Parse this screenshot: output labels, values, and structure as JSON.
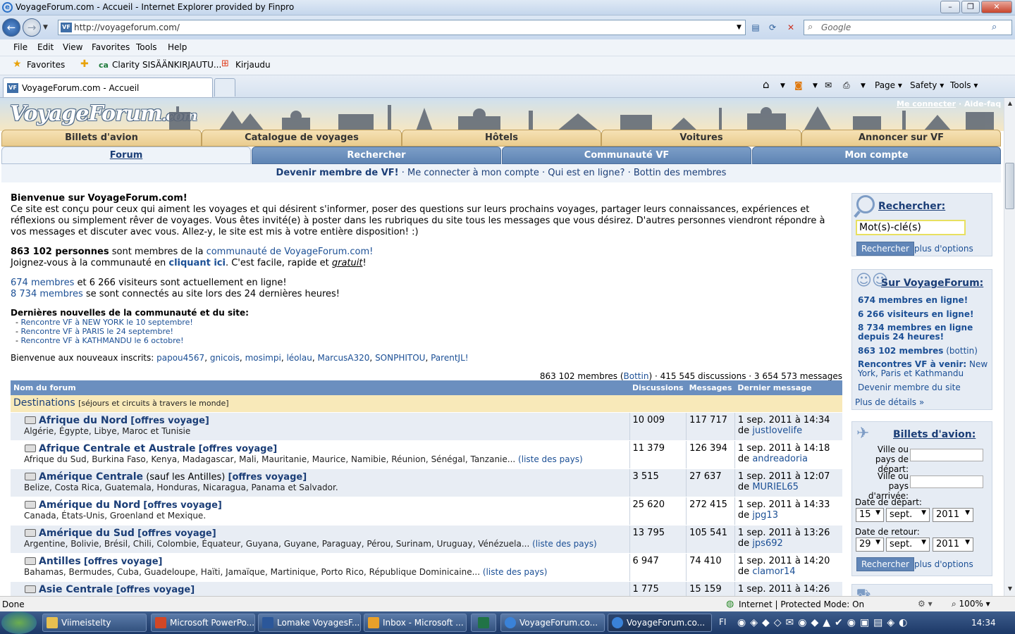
{
  "window": {
    "title": "VoyageForum.com - Accueil - Internet Explorer provided by Finpro",
    "address": "http://voyageforum.com/",
    "search_placeholder": "Google"
  },
  "menu": [
    "File",
    "Edit",
    "View",
    "Favorites",
    "Tools",
    "Help"
  ],
  "favorites_bar": {
    "favorites_label": "Favorites",
    "items": [
      "Clarity SISÄÄNKIRJAUTU...",
      "Kirjaudu"
    ]
  },
  "tab": {
    "title": "VoyageForum.com - Accueil"
  },
  "command_bar": {
    "page": "Page",
    "safety": "Safety",
    "tools": "Tools"
  },
  "site": {
    "logo": "VoyageForum",
    "logo_suffix": ".com",
    "top_links": {
      "login": "Me connecter",
      "separator": " · ",
      "help": "Aide-faq"
    },
    "nav_top": [
      "Billets d'avion",
      "Catalogue de voyages",
      "Hôtels",
      "Voitures",
      "Annoncer sur VF"
    ],
    "nav_main": [
      "Forum",
      "Rechercher",
      "Communauté VF",
      "Mon compte"
    ],
    "subnav": {
      "become_member": "Devenir membre de VF!",
      "login": "Me connecter à mon compte",
      "who_online": "Qui est en ligne?",
      "directory": "Bottin des membres",
      "sep": " · "
    },
    "welcome": {
      "title": "Bienvenue sur VoyageForum.com!",
      "text": "Ce site est conçu pour ceux qui aiment les voyages et qui désirent s'informer, poser des questions sur leurs prochains voyages, partager leurs connaissances, expériences et réflexions ou simplement rêver de voyages. Vous êtes invité(e) à poster dans les rubriques du site tous les messages que vous désirez. D'autres personnes viendront répondre à vos messages et discuter avec vous. Allez-y, le site est mis à votre entière disposition! :)"
    },
    "members": {
      "count": "863 102 personnes",
      "are_members": " sont membres de la ",
      "community_link": "communauté de VoyageForum.com!",
      "join_pre": "Joignez-vous à la communauté en ",
      "join_link": "cliquant ici",
      "join_post": ". C'est facile, rapide et ",
      "free": "gratuit",
      "bang": "!"
    },
    "online": {
      "members_online": "674 membres",
      "online_rest": " et 6 266 visiteurs sont actuellement en ligne!",
      "members_24h": "8 734 membres",
      "rest_24h": " se sont connectés au site lors des 24 dernières heures!"
    },
    "news": {
      "title": "Dernières nouvelles de la communauté et du site:",
      "items": [
        "Rencontre VF à NEW YORK le 10 septembre!",
        "Rencontre VF à PARIS le 24 septembre!",
        "Rencontre VF à KATHMANDU le 6 octobre!"
      ],
      "prefix": "- "
    },
    "new_members": {
      "label": "Bienvenue aux nouveaux inscrits: ",
      "names": [
        "papou4567",
        "gnicois",
        "mosimpi",
        "léolau",
        "MarcusA320",
        "SONPHITOU",
        "ParentJL!"
      ]
    },
    "stats": {
      "pre": "863 102 membres (",
      "bottin": "Bottin",
      "post": ") · 415 545 discussions · 3 654 573 messages"
    },
    "table": {
      "headers": [
        "Nom du forum",
        "Discussions",
        "Messages",
        "Dernier message"
      ],
      "category": {
        "name": "Destinations",
        "sub": "[séjours et circuits à travers le monde]"
      },
      "offers": "[offres voyage]",
      "country_list": "(liste des pays)",
      "by": "de ",
      "rows": [
        {
          "name": "Afrique du Nord",
          "extra": "",
          "desc": "Algérie, Égypte, Libye, Maroc et Tunisie",
          "list": false,
          "disc": "10 009",
          "msgs": "117 717",
          "date": "1 sep. 2011 à 14:34",
          "user": "justlovelife"
        },
        {
          "name": "Afrique Centrale et Australe",
          "extra": "",
          "desc": "Afrique du Sud, Burkina Faso, Kenya, Madagascar, Mali, Mauritanie, Maurice, Namibie, Réunion, Sénégal, Tanzanie...",
          "list": true,
          "disc": "11 379",
          "msgs": "126 394",
          "date": "1 sep. 2011 à 14:18",
          "user": "andreadoria"
        },
        {
          "name": "Amérique Centrale",
          "extra": " (sauf les Antilles)",
          "desc": "Belize, Costa Rica, Guatemala, Honduras, Nicaragua, Panama et Salvador.",
          "list": false,
          "disc": "3 515",
          "msgs": "27 637",
          "date": "1 sep. 2011 à 12:07",
          "user": "MURIEL65"
        },
        {
          "name": "Amérique du Nord",
          "extra": "",
          "desc": "Canada, États-Unis, Groenland et Mexique.",
          "list": false,
          "disc": "25 620",
          "msgs": "272 415",
          "date": "1 sep. 2011 à 14:33",
          "user": "jpg13"
        },
        {
          "name": "Amérique du Sud",
          "extra": "",
          "desc": "Argentine, Bolivie, Brésil, Chili, Colombie, Équateur, Guyana, Guyane, Paraguay, Pérou, Surinam, Uruguay, Vénézuela...",
          "list": true,
          "disc": "13 795",
          "msgs": "105 541",
          "date": "1 sep. 2011 à 13:26",
          "user": "jps692"
        },
        {
          "name": "Antilles",
          "extra": "",
          "desc": "Bahamas, Bermudes, Cuba, Guadeloupe, Haïti, Jamaïque, Martinique, Porto Rico, République Dominicaine...",
          "list": true,
          "disc": "6 947",
          "msgs": "74 410",
          "date": "1 sep. 2011 à 14:20",
          "user": "clamor14"
        },
        {
          "name": "Asie Centrale",
          "extra": "",
          "desc": "",
          "list": false,
          "disc": "1 775",
          "msgs": "15 159",
          "date": "1 sep. 2011 à 14:26",
          "user": ""
        }
      ]
    },
    "sidebar": {
      "search": {
        "title": "Rechercher:",
        "input_value": "Mot(s)-clé(s)",
        "button": "Rechercher",
        "more": "plus d'options"
      },
      "about": {
        "title": "Sur VoyageForum:",
        "online": "674 membres en ligne!",
        "visitors": "6 266 visiteurs en ligne!",
        "last24": "8 734 membres en ligne depuis 24 heures!",
        "members": "863 102 membres",
        "bottin": "(bottin)",
        "meetups_label": "Rencontres VF à venir:",
        "meetups": " New York, Paris et Kathmandu",
        "become": "Devenir membre du site",
        "more": "Plus de détails »"
      },
      "flights": {
        "title": "Billets d'avion:",
        "from_label": "Ville ou pays de départ:",
        "to_label": "Ville ou pays d'arrivée:",
        "dep_label": "Date de départ:",
        "ret_label": "Date de retour:",
        "dep_day": "15",
        "dep_month": "sept.",
        "dep_year": "2011",
        "ret_day": "29",
        "ret_month": "sept.",
        "ret_year": "2011",
        "button": "Rechercher",
        "more": "plus d'options"
      }
    }
  },
  "statusbar": {
    "left": "Done",
    "zone": "Internet | Protected Mode: On",
    "zoom": "100%"
  },
  "taskbar": {
    "buttons": [
      "Viimeistelty",
      "Microsoft PowerPo...",
      "Lomake VoyagesF...",
      "Inbox - Microsoft ...",
      "",
      "VoyageForum.co...",
      "VoyageForum.co..."
    ],
    "lang": "FI",
    "time": "14:34"
  }
}
